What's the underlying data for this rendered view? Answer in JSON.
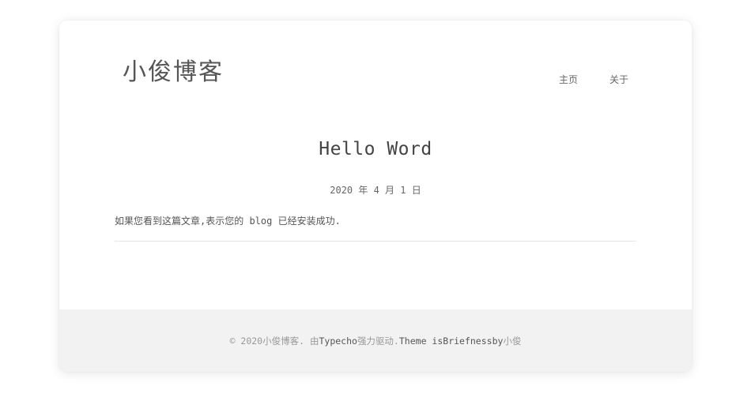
{
  "site": {
    "title": "小俊博客"
  },
  "nav": {
    "items": [
      {
        "label": "主页"
      },
      {
        "label": "关于"
      }
    ]
  },
  "post": {
    "title": "Hello Word",
    "date": "2020 年 4 月 1 日",
    "body": "如果您看到这篇文章,表示您的 blog 已经安装成功."
  },
  "footer": {
    "copyright": "© 2020 ",
    "site_link": "小俊博客",
    "sep1": ". 由 ",
    "typecho_link": "Typecho",
    "sep2": " 强力驱动. ",
    "theme_text": "Theme is ",
    "theme_link": "Briefness",
    "by_text": " by ",
    "author_link": "小俊"
  }
}
